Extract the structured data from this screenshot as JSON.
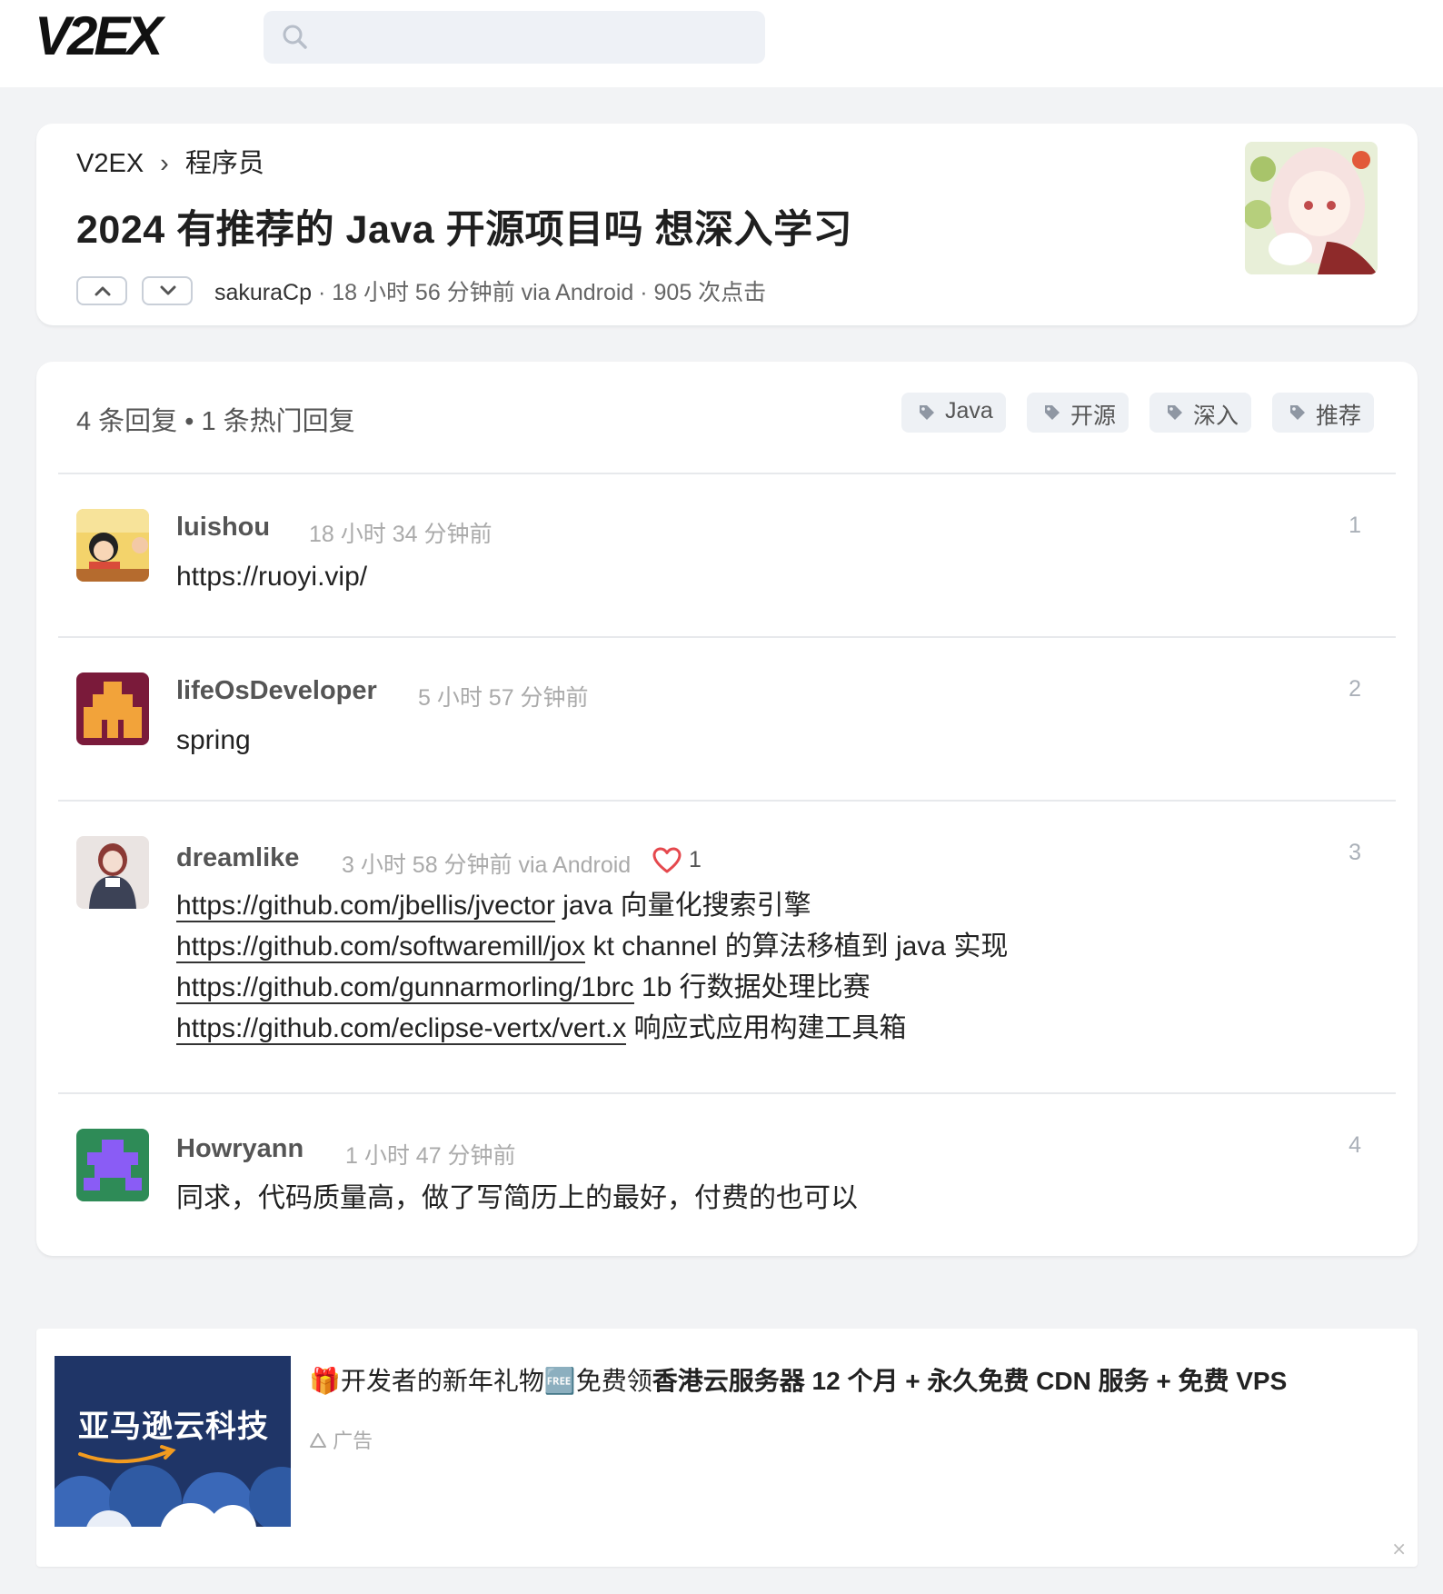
{
  "header": {
    "logo": "V2EX",
    "search_placeholder": ""
  },
  "topic": {
    "breadcrumb_root": "V2EX",
    "breadcrumb_sep": "›",
    "breadcrumb_node": "程序员",
    "title": "2024 有推荐的 Java 开源项目吗 想深入学习",
    "author": "sakuraCp",
    "meta": " · 18 小时 56 分钟前 via Android · 905 次点击"
  },
  "replies_section": {
    "summary": "4 条回复  •  1 条热门回复",
    "tags": [
      "Java",
      "开源",
      "深入",
      "推荐"
    ]
  },
  "replies": [
    {
      "user": "luishou",
      "time": "18 小时 34 分钟前",
      "number": "1",
      "body": "https://ruoyi.vip/"
    },
    {
      "user": "lifeOsDeveloper",
      "time": "5 小时 57 分钟前",
      "number": "2",
      "body": "spring"
    },
    {
      "user": "dreamlike",
      "time": "3 小时 58 分钟前 via Android",
      "number": "3",
      "likes": "1",
      "lines": [
        {
          "link": "https://github.com/jbellis/jvector",
          "text": " java 向量化搜索引擎"
        },
        {
          "link": "https://github.com/softwaremill/jox",
          "text": " kt channel 的算法移植到 java 实现"
        },
        {
          "link": "https://github.com/gunnarmorling/1brc",
          "text": " 1b 行数据处理比赛"
        },
        {
          "link": "https://github.com/eclipse-vertx/vert.x",
          "text": " 响应式应用构建工具箱"
        }
      ]
    },
    {
      "user": "Howryann",
      "time": "1 小时 47 分钟前",
      "number": "4",
      "body": "同求，代码质量高，做了写简历上的最好，付费的也可以"
    }
  ],
  "ad": {
    "image_brand": "亚马逊云科技",
    "title_prefix": "🎁开发者的新年礼物🆓免费领",
    "title_bold": "香港云服务器 12 个月 + 永久免费 CDN 服务 + 免费 VPS",
    "label": "广告",
    "close": "×"
  },
  "colors": {
    "page_bg": "#f2f3f5",
    "card_bg": "#ffffff",
    "tag_bg": "#eef1f5",
    "like_heart": "#e5484d"
  },
  "icons": {
    "search": "search-icon",
    "upvote": "chevron-up-icon",
    "downvote": "chevron-down-icon",
    "tag": "tag-icon",
    "like": "heart-icon",
    "ad": "ad-icon",
    "close": "close-icon"
  }
}
